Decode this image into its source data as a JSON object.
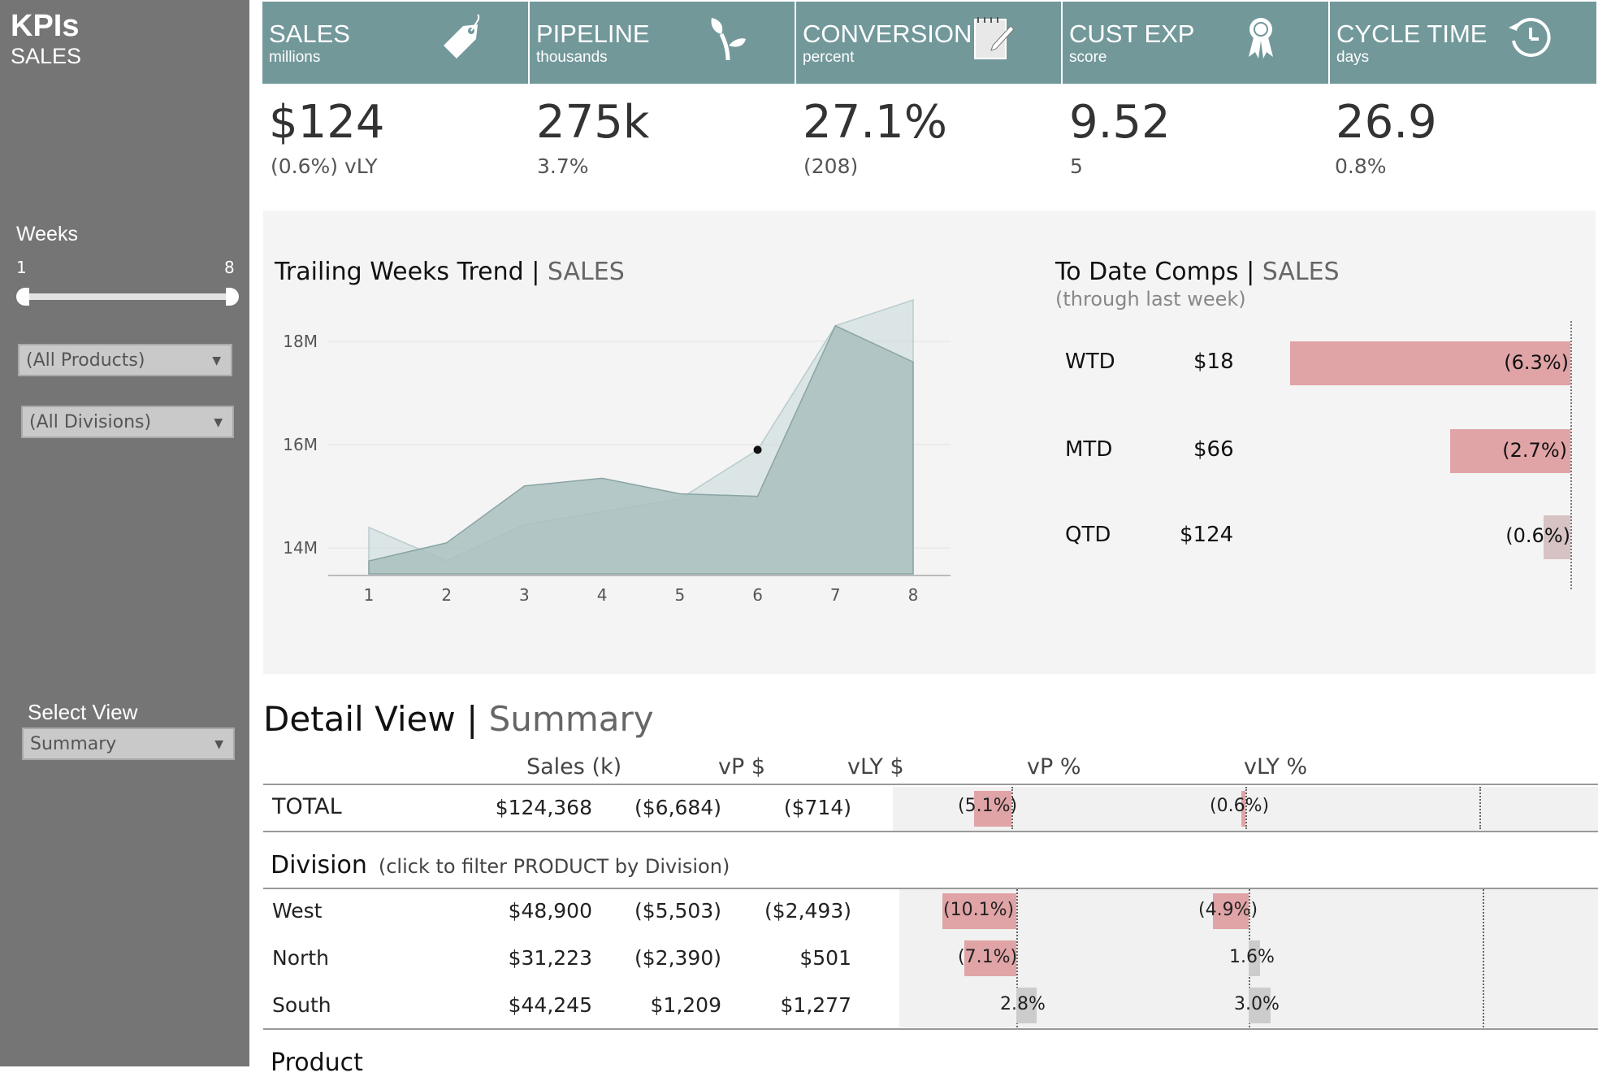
{
  "sidebar": {
    "title": "KPIs",
    "subtitle": "SALES",
    "weeks_label": "Weeks",
    "weeks_min": "1",
    "weeks_max": "8",
    "weeks_range": [
      1,
      8
    ],
    "products_value": "(All Products)",
    "divisions_value": "(All Divisions)",
    "select_view_label": "Select View",
    "select_view_value": "Summary"
  },
  "kpis": [
    {
      "name": "SALES",
      "unit": "millions",
      "value": "$124",
      "delta": "(0.6%) vLY",
      "icon": "price-tag-icon"
    },
    {
      "name": "PIPELINE",
      "unit": "thousands",
      "value": "275k",
      "delta": "3.7%",
      "icon": "sprout-icon"
    },
    {
      "name": "CONVERSION",
      "unit": "percent",
      "value": "27.1%",
      "delta": "(208)",
      "icon": "notepad-icon"
    },
    {
      "name": "CUST EXP",
      "unit": "score",
      "value": "9.52",
      "delta": "5",
      "icon": "award-ribbon-icon"
    },
    {
      "name": "CYCLE TIME",
      "unit": "days",
      "value": "26.9",
      "delta": "0.8%",
      "icon": "clock-icon"
    }
  ],
  "trend": {
    "title": "Trailing Weeks Trend",
    "separator": "|",
    "measure": "SALES"
  },
  "comps": {
    "title": "To Date Comps",
    "separator": "|",
    "measure": "SALES",
    "subtitle": "(through last week)",
    "rows": [
      {
        "period": "WTD",
        "value": "$18",
        "pct": "(6.3%)",
        "pct_value": -6.3
      },
      {
        "period": "MTD",
        "value": "$66",
        "pct": "(2.7%)",
        "pct_value": -2.7
      },
      {
        "period": "QTD",
        "value": "$124",
        "pct": "(0.6%)",
        "pct_value": -0.6
      }
    ]
  },
  "detail": {
    "title": "Detail View",
    "separator": "|",
    "view": "Summary",
    "columns": [
      "Sales (k)",
      "vP $",
      "vLY $",
      "vP %",
      "vLY %"
    ],
    "total": {
      "label": "TOTAL",
      "sales": "$124,368",
      "vp": "($6,684)",
      "vly": "($714)",
      "vp_pct": "(5.1%)",
      "vly_pct": "(0.6%)",
      "vp_pct_value": -5.1,
      "vly_pct_value": -0.6
    },
    "division_header": "Division",
    "division_note": "(click to filter PRODUCT by Division)",
    "divisions": [
      {
        "label": "West",
        "sales": "$48,900",
        "vp": "($5,503)",
        "vly": "($2,493)",
        "vp_pct": "(10.1%)",
        "vly_pct": "(4.9%)",
        "vp_pct_value": -10.1,
        "vly_pct_value": -4.9
      },
      {
        "label": "North",
        "sales": "$31,223",
        "vp": "($2,390)",
        "vly": "$501",
        "vp_pct": "(7.1%)",
        "vly_pct": "1.6%",
        "vp_pct_value": -7.1,
        "vly_pct_value": 1.6
      },
      {
        "label": "South",
        "sales": "$44,245",
        "vp": "$1,209",
        "vly": "$1,277",
        "vp_pct": "2.8%",
        "vly_pct": "3.0%",
        "vp_pct_value": 2.8,
        "vly_pct_value": 3.0
      }
    ],
    "product_header": "Product"
  },
  "colors": {
    "header_teal": "#72989a",
    "sidebar_gray": "#757575",
    "negative_bar": "#e0a4a6",
    "positive_bar": "#cccccc",
    "area_current": "#a9bfbf",
    "area_prior": "#c9d9d9"
  },
  "chart_data": {
    "type": "area",
    "title": "Trailing Weeks Trend | SALES",
    "x": [
      1,
      2,
      3,
      4,
      5,
      6,
      7,
      8
    ],
    "xticks": [
      "1",
      "2",
      "3",
      "4",
      "5",
      "6",
      "7",
      "8"
    ],
    "yticks": [
      "14M",
      "16M",
      "18M"
    ],
    "ytick_values": [
      14,
      16,
      18
    ],
    "ylim": [
      13.5,
      18.8
    ],
    "y_unit": "M",
    "series": [
      {
        "values": [
          13.75,
          14.1,
          15.2,
          15.35,
          15.05,
          15.0,
          18.3,
          17.6
        ]
      },
      {
        "values": [
          14.4,
          13.75,
          14.45,
          14.7,
          14.95,
          15.9,
          18.3,
          18.8
        ]
      }
    ],
    "highlight_point": {
      "x": 6,
      "y": 15.9
    },
    "grid": true
  }
}
